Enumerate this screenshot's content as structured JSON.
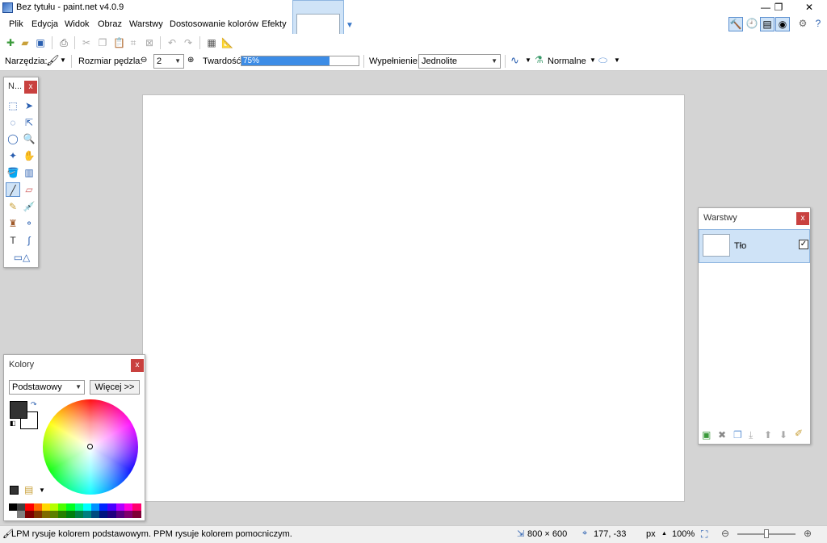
{
  "window": {
    "title": "Bez tytułu - paint.net v4.0.9",
    "minimize": "—",
    "maximize": "❐",
    "close": "✕"
  },
  "menu": [
    {
      "label": "Plik"
    },
    {
      "label": "Edycja"
    },
    {
      "label": "Widok"
    },
    {
      "label": "Obraz"
    },
    {
      "label": "Warstwy"
    },
    {
      "label": "Dostosowanie kolorów"
    },
    {
      "label": "Efekty"
    }
  ],
  "options": {
    "tools_label": "Narzędzia:",
    "brush_size_label": "Rozmiar pędzla:",
    "brush_size_value": "2",
    "hardness_label": "Twardość:",
    "hardness_value": "75%",
    "hardness_fraction": 0.75,
    "fill_label": "Wypełnienie:",
    "fill_value": "Jednolite",
    "blend_value": "Normalne"
  },
  "tools_panel": {
    "title": "N...",
    "close": "x"
  },
  "colors_panel": {
    "title": "Kolory",
    "close": "x",
    "mode_value": "Podstawowy",
    "more_button": "Więcej >>",
    "primary_color": "#333333",
    "secondary_color": "#ffffff",
    "palette_row1": [
      "#000000",
      "#404040",
      "#ff0000",
      "#ff6a00",
      "#ffd800",
      "#b6ff00",
      "#4cff00",
      "#00ff21",
      "#00ff90",
      "#00ffff",
      "#0094ff",
      "#0026ff",
      "#4800ff",
      "#b200ff",
      "#ff00dc",
      "#ff006e"
    ],
    "palette_row2": [
      "#ffffff",
      "#808080",
      "#7f0000",
      "#7f3300",
      "#7f6a00",
      "#5b7f00",
      "#267f00",
      "#007f0e",
      "#007f46",
      "#007f7f",
      "#004a7f",
      "#00137f",
      "#21007f",
      "#57007f",
      "#7f006e",
      "#7f0037"
    ]
  },
  "layers_panel": {
    "title": "Warstwy",
    "close": "x",
    "layers": [
      {
        "name": "Tło",
        "visible": true
      }
    ]
  },
  "status": {
    "hint": "LPM rysuje kolorem podstawowym. PPM rysuje kolorem pomocniczym.",
    "image_size": "800 × 600",
    "cursor_pos": "177, -33",
    "units": "px",
    "zoom": "100%"
  },
  "colors": {
    "accent": "#3c8ce6",
    "close_red": "#c9413f",
    "selection": "#cfe3f7"
  }
}
